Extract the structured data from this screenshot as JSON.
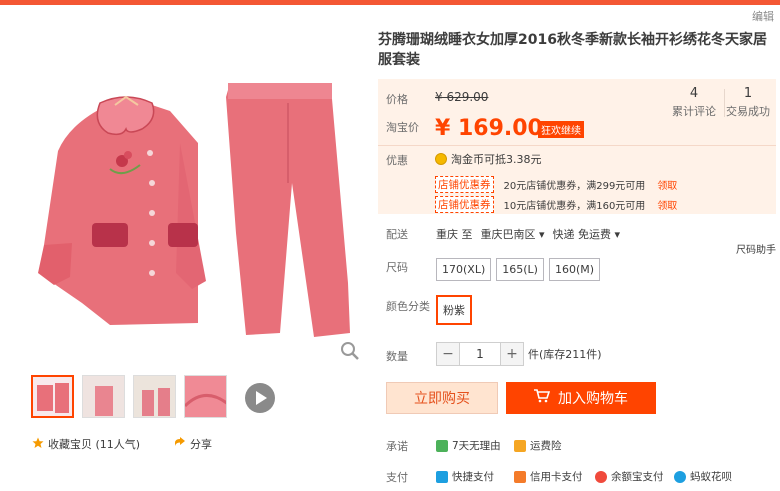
{
  "header": {
    "edit_label": "编辑"
  },
  "product": {
    "title": "芬腾珊瑚绒睡衣女加厚2016秋冬季新款长袖开衫绣花冬天家居服套装"
  },
  "price": {
    "label": "价格",
    "original": "¥ 629.00",
    "promo_label": "淘宝价",
    "promo": "¥ 169.00",
    "promo_tag": "狂欢继续"
  },
  "stats": {
    "reviews_num": "4",
    "reviews_label": "累计评论",
    "sales_num": "1",
    "sales_label": "交易成功"
  },
  "offers": {
    "label": "优惠",
    "coin_text": "淘金币可抵3.38元",
    "coupons": [
      {
        "tag": "店铺优惠券",
        "text": "20元店铺优惠券，满299元可用",
        "action": "领取"
      },
      {
        "tag": "店铺优惠券",
        "text": "10元店铺优惠券，满160元可用",
        "action": "领取"
      }
    ]
  },
  "delivery": {
    "label": "配送",
    "from": "重庆 至",
    "to": "重庆巴南区",
    "method": "快递 免运费",
    "helper": "尺码助手"
  },
  "size": {
    "label": "尺码",
    "options": [
      "170(XL)",
      "165(L)",
      "160(M)"
    ]
  },
  "color": {
    "label": "颜色分类",
    "selected": "粉紫"
  },
  "quantity": {
    "label": "数量",
    "value": "1",
    "minus": "−",
    "plus": "+",
    "stock": "件(库存211件)"
  },
  "actions": {
    "buy_now": "立即购买",
    "add_cart": "加入购物车"
  },
  "promise": {
    "label": "承诺",
    "items": [
      "7天无理由",
      "运费险"
    ]
  },
  "payment": {
    "label": "支付",
    "items": [
      "快捷支付",
      "信用卡支付",
      "余额宝支付",
      "蚂蚁花呗"
    ]
  },
  "gallery": {
    "favorite": "收藏宝贝 (11人气)",
    "share": "分享"
  },
  "colors": {
    "accent": "#ff4400",
    "price_bg": "#fff2e8",
    "pajama_pink": "#e8707a"
  }
}
